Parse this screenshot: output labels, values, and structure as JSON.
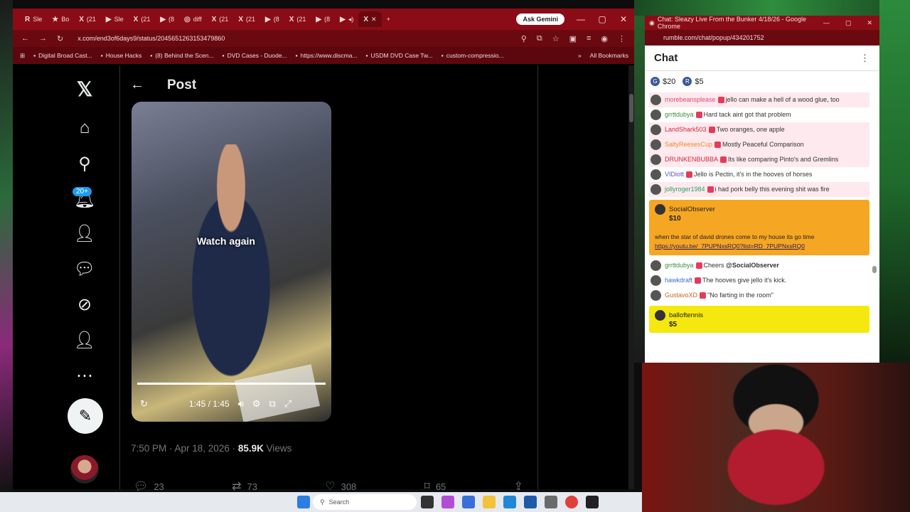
{
  "browser": {
    "tabs": [
      {
        "icon": "R",
        "label": "Sle"
      },
      {
        "icon": "★",
        "label": "Bo"
      },
      {
        "icon": "X",
        "label": "(21"
      },
      {
        "icon": "▶",
        "label": "Sle"
      },
      {
        "icon": "X",
        "label": "(21"
      },
      {
        "icon": "▶",
        "label": "(8"
      },
      {
        "icon": "◎",
        "label": "diff"
      },
      {
        "icon": "X",
        "label": "(21"
      },
      {
        "icon": "X",
        "label": "(21"
      },
      {
        "icon": "▶",
        "label": "(8"
      },
      {
        "icon": "X",
        "label": "(21"
      },
      {
        "icon": "▶",
        "label": "(8"
      },
      {
        "icon": "▶",
        "label": "◂)"
      },
      {
        "icon": "X",
        "label": "✕"
      }
    ],
    "new_tab": "+",
    "gemini_label": "Ask Gemini",
    "url": "x.com/end3of6days9/status/2045651263153479860",
    "bookmarks": [
      "Digital Broad Cast...",
      "House Hacks",
      "(8) Behind the Scen...",
      "DVD Cases - Duode...",
      "https://www.discma...",
      "USDM DVD Case Tw...",
      "custom-compressio..."
    ],
    "all_bookmarks": "All Bookmarks"
  },
  "x": {
    "header_title": "Post",
    "notification_badge": "20+",
    "video": {
      "overlay": "Watch again",
      "time": "1:45 / 1:45",
      "progress_percent": 100
    },
    "meta_time": "7:50 PM · Apr 18, 2026 · ",
    "meta_views_count": "85.9K",
    "meta_views_label": " Views",
    "actions": {
      "replies": "23",
      "reposts": "73",
      "likes": "308",
      "bookmarks": "65"
    }
  },
  "chat": {
    "window_title": "Chat: Sleazy Live From the Bunker 4/18/26 - Google Chrome",
    "url": "rumble.com/chat/popup/434201752",
    "header": "Chat",
    "rant_pins": [
      "$20",
      "$5"
    ],
    "messages": [
      {
        "user": "morebeansplease",
        "text": "jello can make a hell of a wood glue, too",
        "color": "#e0457b",
        "pink": true
      },
      {
        "user": "grrttdubya",
        "text": "Hard tack aint got that problem",
        "color": "#3a8f3a",
        "pink": false
      },
      {
        "user": "LandShark503",
        "text": "Two oranges, one apple",
        "color": "#d1273e",
        "pink": true
      },
      {
        "user": "SaltyReesesCup",
        "text": "Mostly Peaceful Comparison",
        "color": "#e88a2a",
        "pink": true
      },
      {
        "user": "DRUNKENBUBBA",
        "text": "Its like comparing Pinto's and Gremlins",
        "color": "#d1273e",
        "pink": true
      },
      {
        "user": "VIDiott",
        "text": "Jello is Pectin, it's in the hooves of horses",
        "color": "#5a4fc9",
        "pink": false
      },
      {
        "user": "jollyroger1984",
        "text": "i had pork belly this evening shit was fire",
        "color": "#2a9f6a",
        "pink": true
      }
    ],
    "rant1": {
      "user": "SocialObserver",
      "amount": "$10",
      "text": "when the star of david drones come to my house its go time ",
      "link": "https://youtu.be/_7PUPNxsRQ0?list=RD_7PUPNxsRQ0"
    },
    "messages2": [
      {
        "user": "grrttdubya",
        "text": "Cheers ",
        "mention": "@SocialObserver",
        "color": "#3a8f3a"
      },
      {
        "user": "hawkdraft",
        "text": "The hooves give jello it's kick.",
        "mention": "",
        "color": "#3b6cc9"
      },
      {
        "user": "GustavoXD",
        "text": "\"No farting in the room\"",
        "mention": "",
        "color": "#c9651a"
      }
    ],
    "rant2": {
      "user": "balloftennis",
      "amount": "$5"
    }
  },
  "taskbar": {
    "search": "Search"
  },
  "colors": {
    "tab_bar": "#8b0c16",
    "x_bg": "#000000",
    "rant_orange": "#f5a623",
    "rant_yellow": "#f5e80f"
  }
}
